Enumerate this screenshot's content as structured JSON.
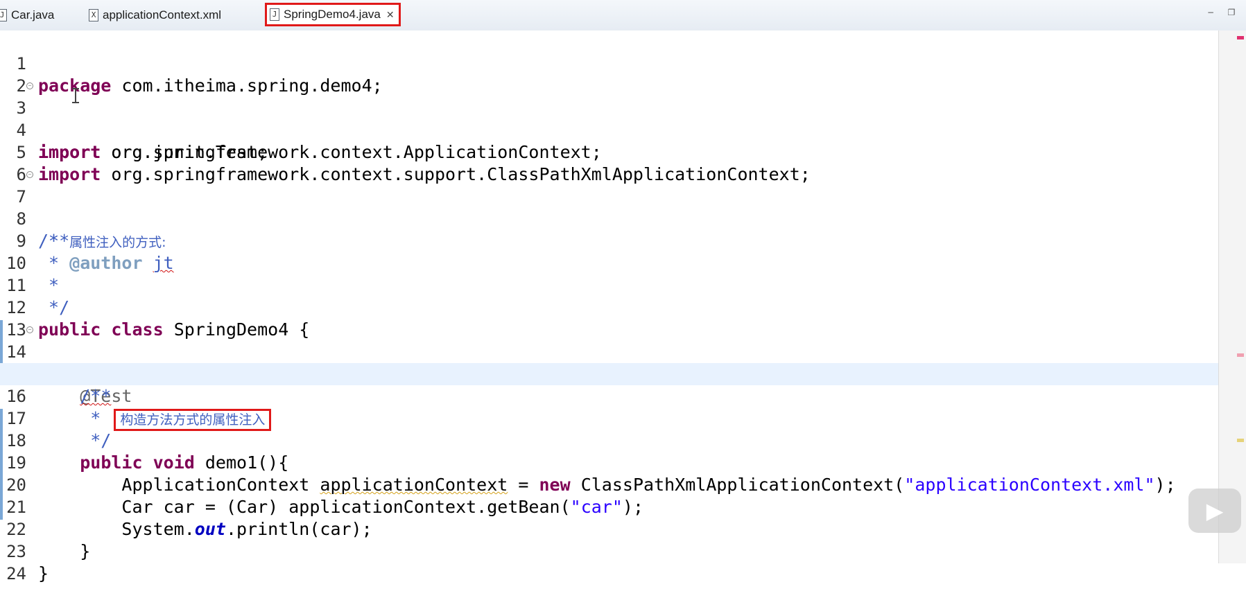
{
  "tabs": [
    {
      "label": "Car.java",
      "icon": "java-file-icon",
      "glyph": "J"
    },
    {
      "label": "applicationContext.xml",
      "icon": "xml-file-icon",
      "glyph": "X"
    },
    {
      "label": "SpringDemo4.java",
      "icon": "java-file-icon",
      "glyph": "J",
      "active": true,
      "close": "✕"
    }
  ],
  "window_controls": {
    "minimize": "−",
    "restore": "❐"
  },
  "editor": {
    "current_line": 16,
    "lines": {
      "l1": {
        "n": "1",
        "kw": "package",
        "rest": " com.itheima.spring.demo4;"
      },
      "l2": {
        "n": "2"
      },
      "l3": {
        "n": "3",
        "kw": "import",
        "rest": " org.junit.Test;"
      },
      "l4": {
        "n": "4",
        "kw": "import",
        "rest": " org.springframework.context.ApplicationContext;"
      },
      "l5": {
        "n": "5",
        "kw": "import",
        "rest": " org.springframework.context.support.ClassPathXmlApplicationContext;"
      },
      "l6": {
        "n": "6"
      },
      "l7": {
        "n": "7",
        "cm": "/**"
      },
      "l8": {
        "n": "8",
        "star": " * ",
        "cn": "属性注入的方式:"
      },
      "l9": {
        "n": "9",
        "star": " * ",
        "tag": "@author",
        "sp": " ",
        "name": "jt"
      },
      "l10": {
        "n": "10",
        "star": " *"
      },
      "l11": {
        "n": "11",
        "star": " */"
      },
      "l12": {
        "n": "12",
        "kw1": "public",
        "sp1": " ",
        "kw2": "class",
        "rest": " SpringDemo4 {"
      },
      "l13": {
        "n": "13"
      },
      "l14": {
        "n": "14",
        "ann": "    @Test"
      },
      "l15": {
        "n": "15",
        "ind": "    ",
        "cm": "/**"
      },
      "l16": {
        "n": "16",
        "star": "     * ",
        "cn": "构造方法方式的属性注入"
      },
      "l17": {
        "n": "17",
        "star": "     */"
      },
      "l18": {
        "n": "18",
        "ind": "    ",
        "kw1": "public",
        "sp1": " ",
        "kw2": "void",
        "rest": " demo1(){"
      },
      "l19": {
        "n": "19",
        "ind": "        ",
        "t1": "ApplicationContext ",
        "var": "applicationContext",
        "t2": " = ",
        "kw": "new",
        "t3": " ClassPathXmlApplicationContext(",
        "str": "\"applicationContext.xml\"",
        "t4": ");"
      },
      "l20": {
        "n": "20",
        "ind": "        ",
        "t1": "Car car = (Car) applicationContext.getBean(",
        "str": "\"car\"",
        "t2": ");"
      },
      "l21": {
        "n": "21",
        "ind": "        ",
        "t1": "System.",
        "out": "out",
        "t2": ".println(car);"
      },
      "l22": {
        "n": "22",
        "rest": "    }"
      },
      "l23": {
        "n": "23",
        "rest": "}"
      },
      "l24": {
        "n": "24"
      }
    }
  },
  "overlay": {
    "play_glyph": "▶"
  }
}
